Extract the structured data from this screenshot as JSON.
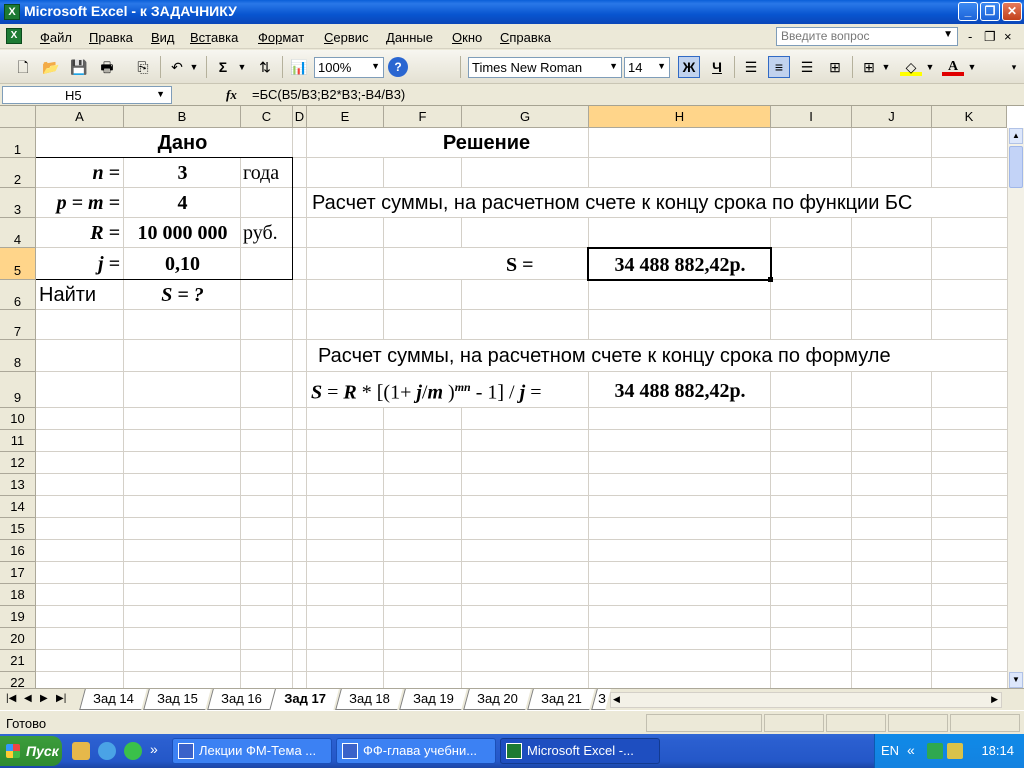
{
  "window": {
    "title": "Microsoft Excel - к ЗАДАЧНИКУ",
    "app_icon": "excel-icon",
    "min_glyph": "_",
    "max_glyph": "❐",
    "close_glyph": "✕"
  },
  "menu": {
    "items": [
      {
        "u": "Ф",
        "rest": "айл"
      },
      {
        "u": "П",
        "rest": "равка"
      },
      {
        "u": "В",
        "rest": "ид"
      },
      {
        "u": "Вст",
        "rest": "авка"
      },
      {
        "u": "Фор",
        "rest": "мат"
      },
      {
        "u": "С",
        "rest": "ервис"
      },
      {
        "u": "Д",
        "rest": "анные"
      },
      {
        "u": "О",
        "rest": "кно"
      },
      {
        "u": "С",
        "rest": "правка"
      }
    ],
    "ask_placeholder": "Введите вопрос",
    "doc_min": "-",
    "doc_restore": "❐",
    "doc_close": "×"
  },
  "toolbar": {
    "zoom": "100%",
    "font_name": "Times New Roman",
    "font_size": "14",
    "bold_label": "Ж",
    "underline_label": "Ч",
    "sum_label": "Σ"
  },
  "formula_bar": {
    "cell_ref": "H5",
    "fx_label": "fx",
    "formula": "=БС(B5/B3;B2*B3;-B4/B3)"
  },
  "sheet": {
    "columns": [
      "A",
      "B",
      "C",
      "D",
      "E",
      "F",
      "G",
      "H",
      "I",
      "J",
      "K"
    ],
    "selected_column": "H",
    "selected_row": "5",
    "rows": [
      "1",
      "2",
      "3",
      "4",
      "5",
      "6",
      "7",
      "8",
      "9",
      "10",
      "11",
      "12",
      "13",
      "14",
      "15",
      "16",
      "17",
      "18",
      "19",
      "20",
      "21",
      "22"
    ],
    "cells": {
      "B1": "Дано",
      "A2": "n =",
      "B2": "3",
      "C2": "года",
      "A3": "p = m =",
      "B3": "4",
      "A4": "R =",
      "B4": "10 000 000",
      "C4": "руб.",
      "A5": "j =",
      "B5": "0,10",
      "A6": "Найти",
      "B6": "S =  ?",
      "F1": "Решение",
      "E3": "Расчет суммы, на расчетном счете к концу срока по функции БС",
      "F5": "S  =",
      "H5": "34 488 882,42р.",
      "E8": "Расчет суммы, на расчетном счете к концу срока по формуле",
      "E9_formula": {
        "s": "S",
        "eq": " = ",
        "r": "R",
        "mid1": " * [(1+ ",
        "j": "j",
        "slash": "/",
        "m": "m",
        "close": " )",
        "sup": "mn",
        "mid2": " - 1] / ",
        "j2": "j",
        "end": " ="
      },
      "H9": "34 488 882,42р."
    }
  },
  "tabs": {
    "items": [
      "Зад 14",
      "Зад 15",
      "Зад 16",
      "Зад 17",
      "Зад 18",
      "Зад 19",
      "Зад 20",
      "Зад 21",
      "З"
    ],
    "active": "Зад 17"
  },
  "status": {
    "text": "Готово"
  },
  "taskbar": {
    "start_label": "Пуск",
    "tasks": [
      "Лекции ФМ-Тема ...",
      "ФФ-глава учебни...",
      "Microsoft Excel -..."
    ],
    "lang": "EN",
    "chevron": "«",
    "quicklaunch_more": "»",
    "clock": "18:14"
  }
}
